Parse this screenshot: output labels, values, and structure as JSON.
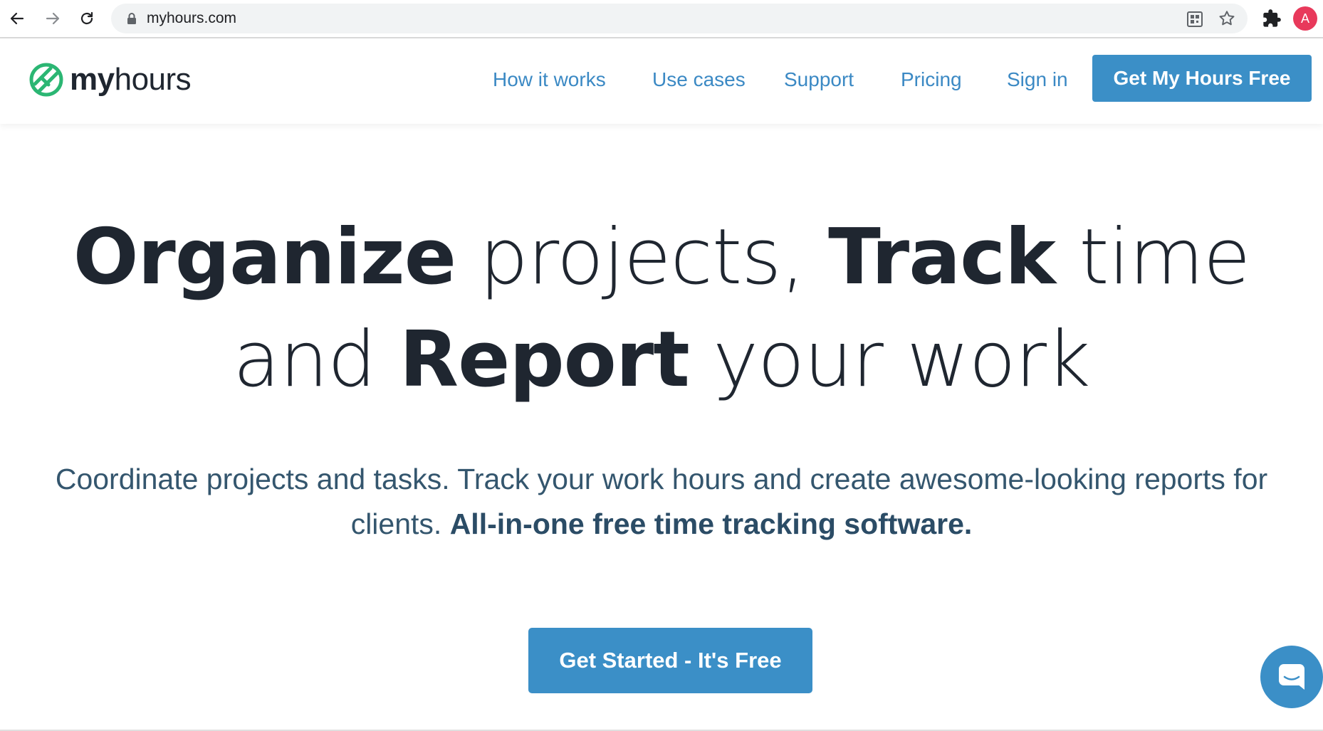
{
  "browser": {
    "url": "myhours.com",
    "profile_initial": "A"
  },
  "header": {
    "logo_bold": "my",
    "logo_rest": "hours",
    "nav": {
      "how_it_works": "How it works",
      "use_cases": "Use cases",
      "support": "Support",
      "pricing": "Pricing",
      "sign_in": "Sign in"
    },
    "cta_label": "Get My Hours Free"
  },
  "hero": {
    "h_organize": "Organize",
    "h_projects": "projects,",
    "h_track": "Track",
    "h_time": "time",
    "h_and": "and",
    "h_report": "Report",
    "h_your_work": "your work",
    "sub_text": "Coordinate projects and tasks. Track your work hours and create awesome-looking reports for clients.",
    "sub_bold": "All-in-one free time tracking software.",
    "cta_label": "Get Started - It's Free"
  },
  "colors": {
    "accent": "#3b8fc7",
    "nav_link": "#3b89c4",
    "logo_green": "#2bb673",
    "headline": "#1f2630",
    "subtext": "#34566e",
    "avatar": "#e8395b"
  }
}
